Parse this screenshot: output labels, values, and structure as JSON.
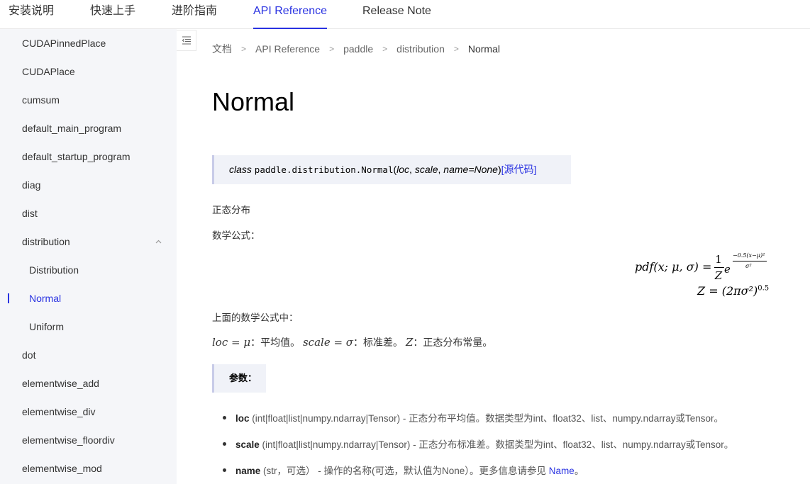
{
  "topnav": {
    "tabs": [
      {
        "label": "安装说明"
      },
      {
        "label": "快速上手"
      },
      {
        "label": "进阶指南"
      },
      {
        "label": "API Reference",
        "active": true
      },
      {
        "label": "Release Note"
      }
    ]
  },
  "sidebar": {
    "items": [
      {
        "label": "CUDAPinnedPlace"
      },
      {
        "label": "CUDAPlace"
      },
      {
        "label": "cumsum"
      },
      {
        "label": "default_main_program"
      },
      {
        "label": "default_startup_program"
      },
      {
        "label": "diag"
      },
      {
        "label": "dist"
      },
      {
        "label": "distribution",
        "expanded": true
      },
      {
        "label": "Distribution",
        "child": true
      },
      {
        "label": "Normal",
        "child": true,
        "active": true
      },
      {
        "label": "Uniform",
        "child": true
      },
      {
        "label": "dot"
      },
      {
        "label": "elementwise_add"
      },
      {
        "label": "elementwise_div"
      },
      {
        "label": "elementwise_floordiv"
      },
      {
        "label": "elementwise_mod"
      }
    ]
  },
  "breadcrumb": [
    "文档",
    "API Reference",
    "paddle",
    "distribution",
    "Normal"
  ],
  "page_title": "Normal",
  "signature": {
    "class_kw": "class",
    "path": "paddle.distribution.Normal",
    "open": "(",
    "arg1": "loc",
    "sep1": ", ",
    "arg2": "scale",
    "sep2": ", ",
    "arg3": "name=None",
    "close": ")",
    "source_link": "[源代码]"
  },
  "body": {
    "intro": "正态分布",
    "formula_label": "数学公式：",
    "after_formula": "上面的数学公式中：",
    "variables": {
      "loc_eq": "loc = μ",
      "loc_desc": "：平均值。",
      "scale_eq": "scale = σ",
      "scale_desc": "：标准差。",
      "z_eq": "Z",
      "z_desc": "：正态分布常量。"
    }
  },
  "formula": {
    "lhs": "pdf(x; μ, σ) =",
    "num": "1",
    "den": "Z",
    "base": "e",
    "exp_num": "−0.5(x−μ)²",
    "exp_den": "σ²",
    "line2": "Z = (2πσ²)",
    "line2_exp": "0.5"
  },
  "params": {
    "heading": "参数：",
    "items": [
      {
        "name": "loc",
        "desc": " (int|float|list|numpy.ndarray|Tensor) - 正态分布平均值。数据类型为int、float32、list、numpy.ndarray或Tensor。"
      },
      {
        "name": "scale",
        "desc": " (int|float|list|numpy.ndarray|Tensor) - 正态分布标准差。数据类型为int、float32、list、numpy.ndarray或Tensor。"
      },
      {
        "name": "name",
        "desc": " (str，可选） - 操作的名称(可选，默认值为None）。更多信息请参见 ",
        "link": "Name",
        "tail": "。"
      }
    ]
  },
  "colors": {
    "accent": "#2932e1",
    "sidebar_bg": "#f5f6f9",
    "box_bg": "#f0f2f8"
  }
}
